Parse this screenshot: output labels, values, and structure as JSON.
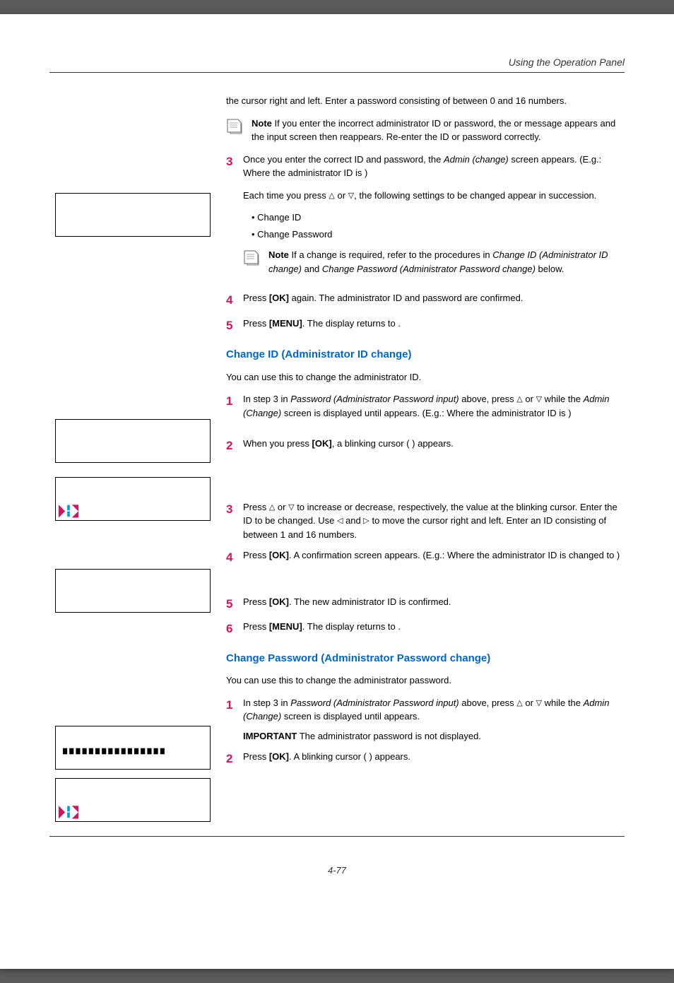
{
  "header": {
    "section": "Using the Operation Panel"
  },
  "intro": {
    "p1": "the cursor right and left. Enter a password consisting of between 0 and 16 numbers."
  },
  "note1": {
    "label": "Note",
    "text1": "  If you enter the incorrect administrator ID or password, the ",
    "text2": " or ",
    "text3": " message appears and the input screen then reappears. Re-enter the ID or password correctly."
  },
  "step3": {
    "num": "3",
    "p1a": "Once you enter the correct ID and password, the ",
    "p1b": "Admin (change)",
    "p1c": " screen appears. (E.g.: Where the administrator ID is ",
    "p1d": ")",
    "p2a": "Each time you press ",
    "p2b": " or ",
    "p2c": ", the following settings to be changed appear in succession.",
    "b1": "Change ID",
    "b2": "Change Password"
  },
  "note2": {
    "label": "Note",
    "t1": "  If a change is required, refer to the procedures in ",
    "t2": "Change ID (Administrator ID change)",
    "t3": " and ",
    "t4": "Change Password (Administrator Password change)",
    "t5": " below."
  },
  "step4": {
    "num": "4",
    "p": "Press ",
    "ok": "[OK]",
    "p2": " again. The administrator ID and password are confirmed."
  },
  "step5": {
    "num": "5",
    "p": "Press ",
    "menu": "[MENU]",
    "p2": ". The display returns to ",
    "p3": "."
  },
  "sec1": {
    "title": "Change ID (Administrator ID change)",
    "intro": "You can use this to change the administrator ID."
  },
  "sec1s1": {
    "num": "1",
    "p1": "In step 3 in ",
    "p2": "Password (Administrator Password input)",
    "p3": " above, press ",
    "p4": " or ",
    "p5": " while the ",
    "p6": "Admin (Change)",
    "p7": " screen is displayed until ",
    "p8": " appears. (E.g.: Where the administrator ID is ",
    "p9": ")"
  },
  "sec1s2": {
    "num": "2",
    "p1": "When you press ",
    "ok": "[OK]",
    "p2": ", a blinking cursor (  ) appears."
  },
  "sec1s3": {
    "num": "3",
    "p1": "Press ",
    "p2": " or ",
    "p3": " to increase or decrease, respectively, the value at the blinking cursor. Enter the ID to be changed. Use ",
    "p4": " and ",
    "p5": " to move the cursor right and left. Enter an ID consisting of between 1 and 16 numbers."
  },
  "sec1s4": {
    "num": "4",
    "p1": "Press ",
    "ok": "[OK]",
    "p2": ". A confirmation screen appears. (E.g.: Where the administrator ID is changed to ",
    "p3": ")"
  },
  "sec1s5": {
    "num": "5",
    "p1": "Press ",
    "ok": "[OK]",
    "p2": ". The new administrator ID is confirmed."
  },
  "sec1s6": {
    "num": "6",
    "p1": "Press ",
    "menu": "[MENU]",
    "p2": ". The display returns to ",
    "p3": "."
  },
  "sec2": {
    "title": "Change Password (Administrator Password change)",
    "intro": "You can use this to change the administrator password."
  },
  "sec2s1": {
    "num": "1",
    "p1": "In step 3 in ",
    "p2": "Password (Administrator Password input)",
    "p3": " above, press ",
    "p4": " or ",
    "p5": " while the ",
    "p6": "Admin (Change)",
    "p7": " screen is displayed until ",
    "p8": " appears.",
    "imp_label": "IMPORTANT",
    "imp_text": "  The administrator password is not displayed."
  },
  "sec2s2": {
    "num": "2",
    "p1": "Press ",
    "ok": "[OK]",
    "p2": ". A blinking cursor (  ) appears."
  },
  "pagenum": "4-77"
}
